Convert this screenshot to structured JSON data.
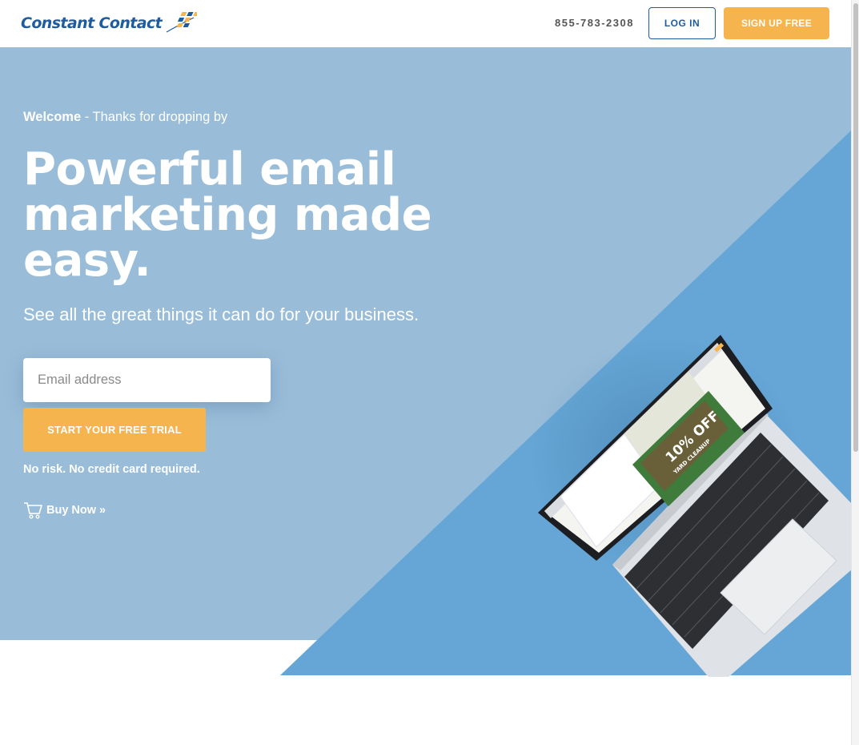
{
  "header": {
    "logo_text": "Constant Contact",
    "logo_icon": "constant-contact-logo-icon",
    "phone": "855-783-2308",
    "login_label": "LOG IN",
    "signup_label": "SIGN UP FREE"
  },
  "hero": {
    "welcome_bold": "Welcome",
    "welcome_rest": " - Thanks for dropping by",
    "headline": "Powerful email marketing made easy.",
    "subline": "See all the great things it can do for your business.",
    "email_placeholder": "Email address",
    "email_value": "",
    "trial_label": "START YOUR FREE TRIAL",
    "no_risk": "No risk. No credit card required.",
    "buy_now": "Buy Now »",
    "cart_icon": "shopping-cart-icon",
    "promo_text": "10% OFF",
    "promo_sub": "YARD CLEANUP"
  },
  "colors": {
    "brand_blue": "#1f5b9f",
    "accent_orange": "#f6b44e",
    "hero_light": "#99bdd9",
    "hero_dark": "#65a6d6"
  }
}
